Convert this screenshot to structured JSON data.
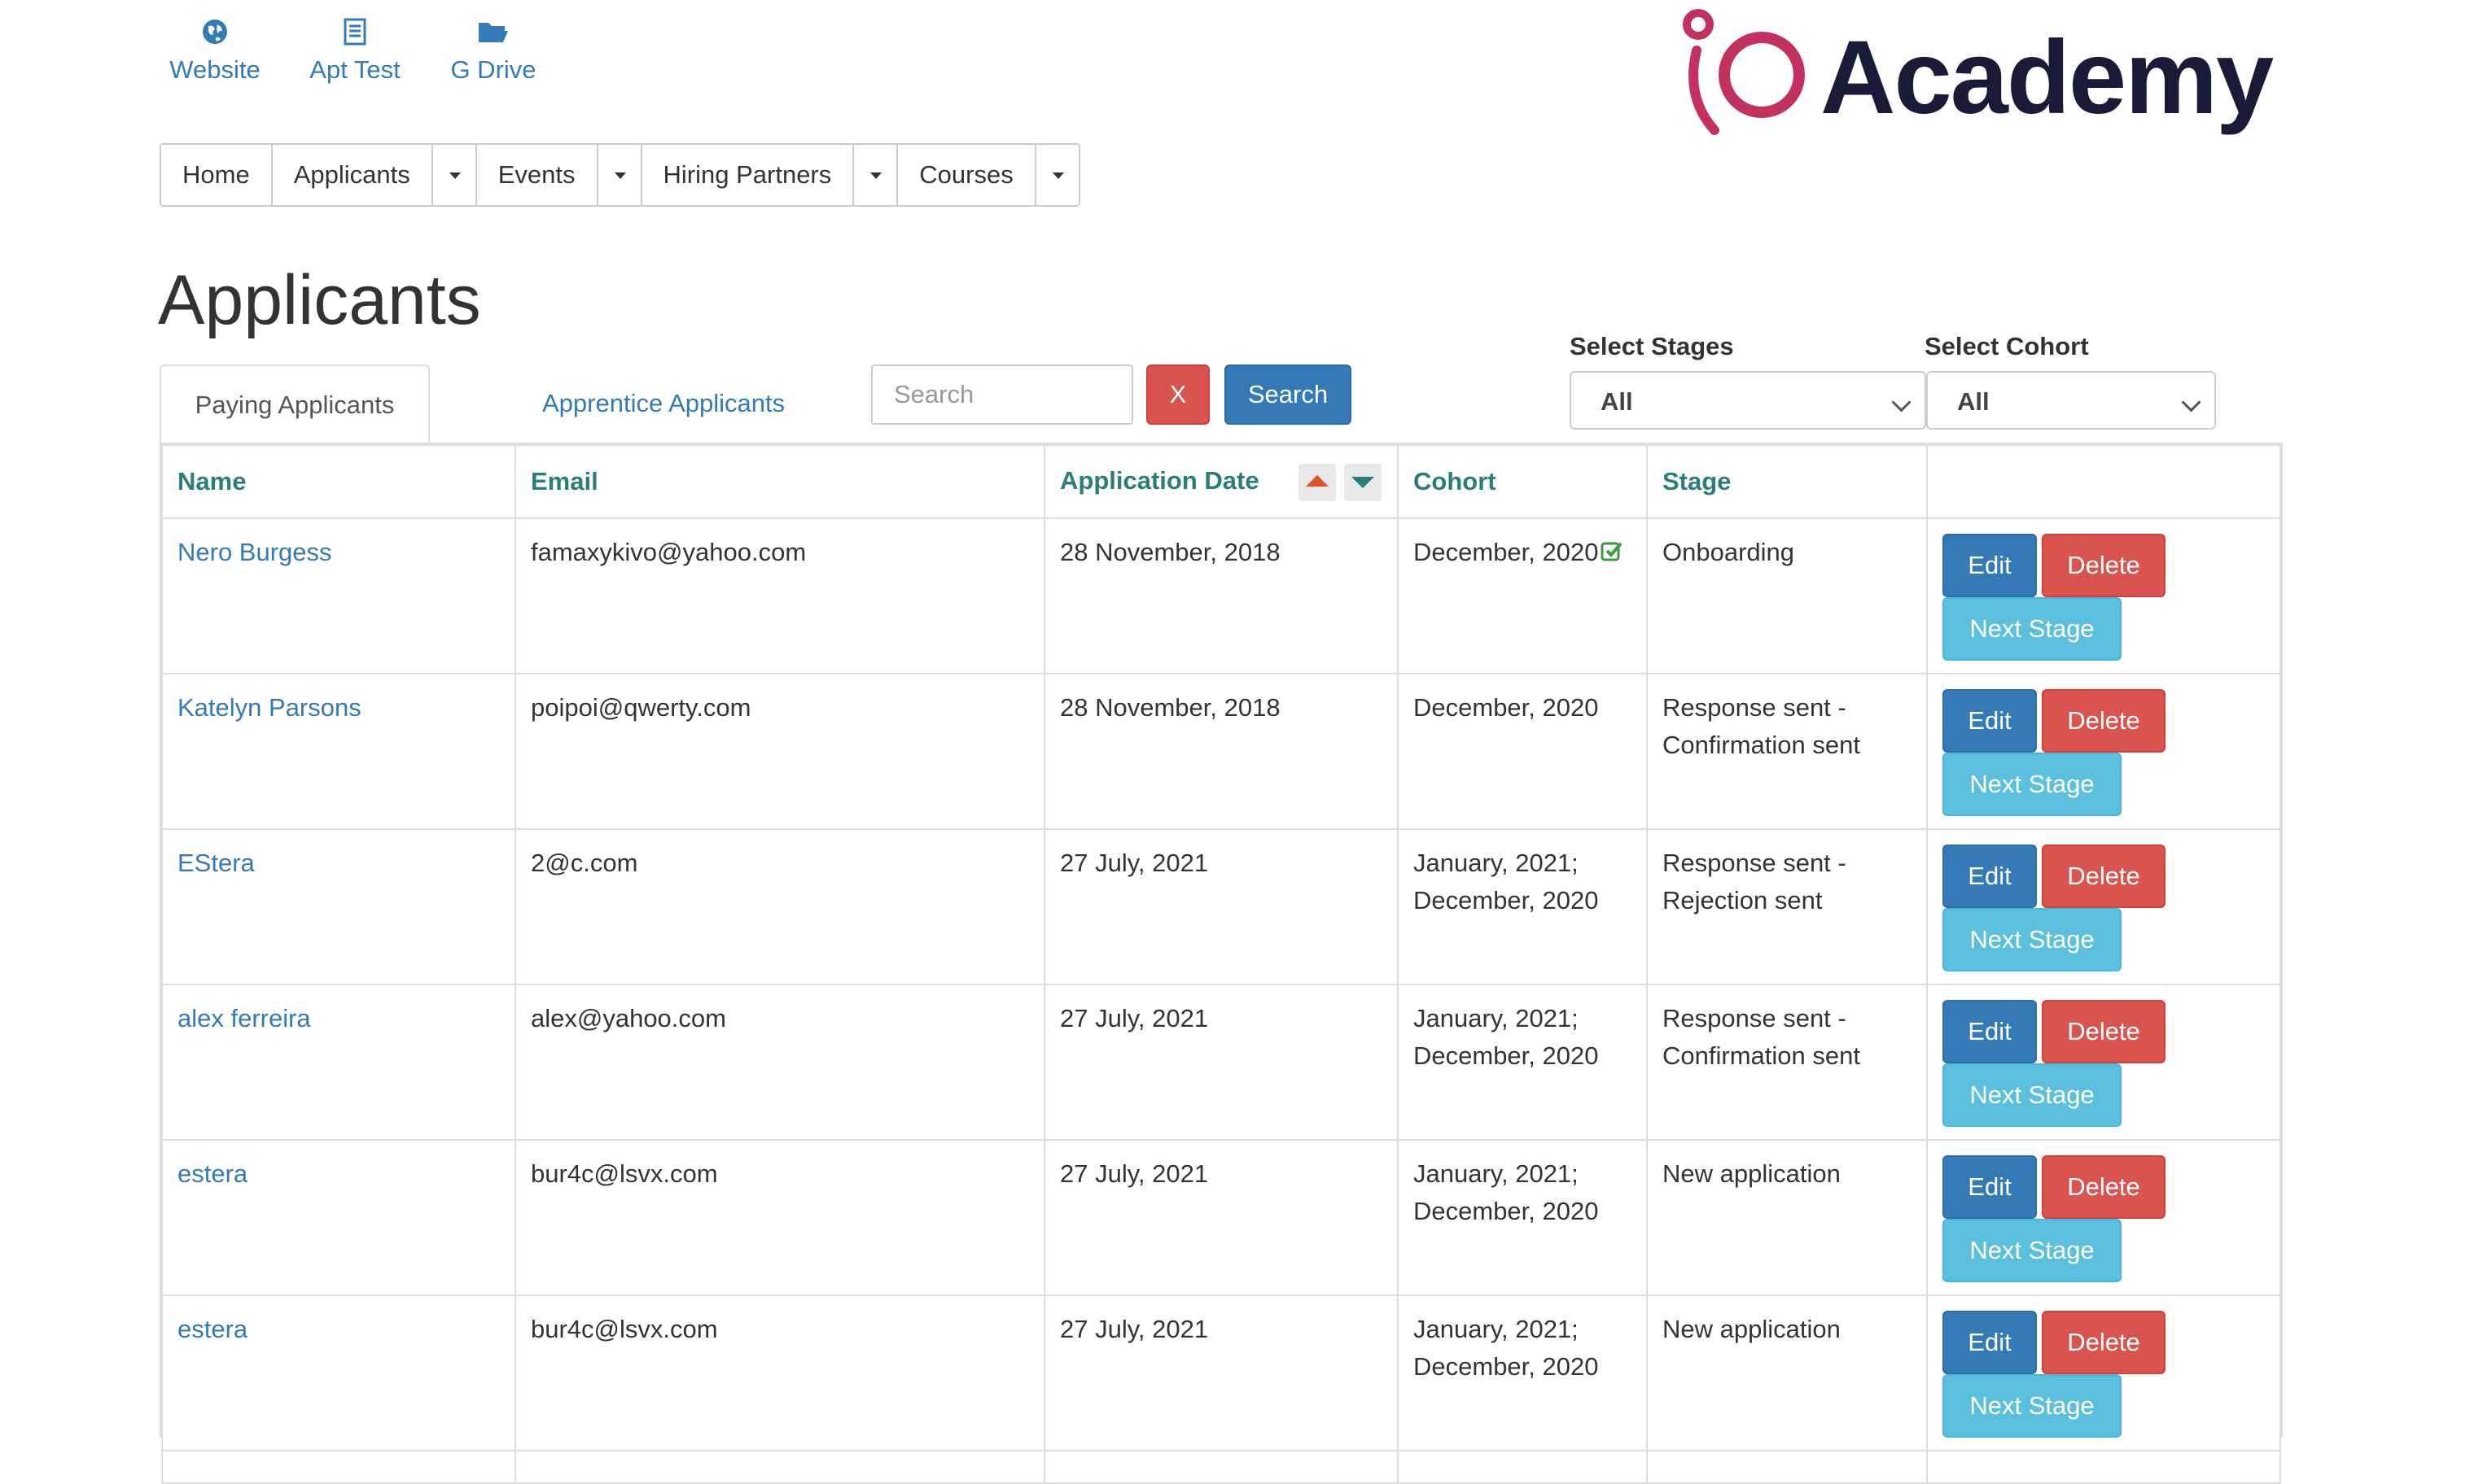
{
  "quick_links": [
    {
      "label": "Website",
      "icon": "globe-icon"
    },
    {
      "label": "Apt Test",
      "icon": "list-icon"
    },
    {
      "label": "G Drive",
      "icon": "folder-open-icon"
    }
  ],
  "brand": {
    "name": "Academy",
    "mark_color": "#c3325f",
    "text_color": "#1b1b38"
  },
  "nav": {
    "home": "Home",
    "applicants": "Applicants",
    "events": "Events",
    "hiring_partners": "Hiring Partners",
    "courses": "Courses"
  },
  "page_title": "Applicants",
  "tabs": {
    "paying": "Paying Applicants",
    "apprentice": "Apprentice Applicants"
  },
  "search": {
    "placeholder": "Search",
    "clear_label": "X",
    "button_label": "Search"
  },
  "filters": {
    "stages": {
      "label": "Select Stages",
      "value": "All"
    },
    "cohort": {
      "label": "Select Cohort",
      "value": "All"
    }
  },
  "table": {
    "headers": {
      "name": "Name",
      "email": "Email",
      "application_date": "Application Date",
      "cohort": "Cohort",
      "stage": "Stage"
    },
    "actions": {
      "edit": "Edit",
      "delete": "Delete",
      "next_stage": "Next Stage"
    },
    "rows": [
      {
        "name": "Nero Burgess",
        "email": "famaxykivo@yahoo.com",
        "date": "28 November, 2018",
        "cohort": [
          "December, 2020"
        ],
        "cohort_confirmed": true,
        "stage": [
          "Onboarding"
        ]
      },
      {
        "name": "Katelyn Parsons",
        "email": "poipoi@qwerty.com",
        "date": "28 November, 2018",
        "cohort": [
          "December, 2020"
        ],
        "cohort_confirmed": false,
        "stage": [
          "Response sent -",
          "Confirmation sent"
        ]
      },
      {
        "name": "EStera",
        "email": "2@c.com",
        "date": "27 July, 2021",
        "cohort": [
          "January, 2021;",
          "December, 2020"
        ],
        "cohort_confirmed": false,
        "stage": [
          "Response sent -",
          "Rejection sent"
        ]
      },
      {
        "name": "alex ferreira",
        "email": "alex@yahoo.com",
        "date": "27 July, 2021",
        "cohort": [
          "January, 2021;",
          "December, 2020"
        ],
        "cohort_confirmed": false,
        "stage": [
          "Response sent -",
          "Confirmation sent"
        ]
      },
      {
        "name": "estera",
        "email": "bur4c@lsvx.com",
        "date": "27 July, 2021",
        "cohort": [
          "January, 2021;",
          "December, 2020"
        ],
        "cohort_confirmed": false,
        "stage": [
          "New application"
        ]
      },
      {
        "name": "estera",
        "email": "bur4c@lsvx.com",
        "date": "27 July, 2021",
        "cohort": [
          "January, 2021;",
          "December, 2020"
        ],
        "cohort_confirmed": false,
        "stage": [
          "New application"
        ]
      }
    ]
  },
  "colors": {
    "link": "#337ab7",
    "header_text": "#2a7d7b",
    "danger": "#d9534f",
    "primary": "#337ab7",
    "info": "#5bc0de",
    "success": "#3c9a3c"
  }
}
